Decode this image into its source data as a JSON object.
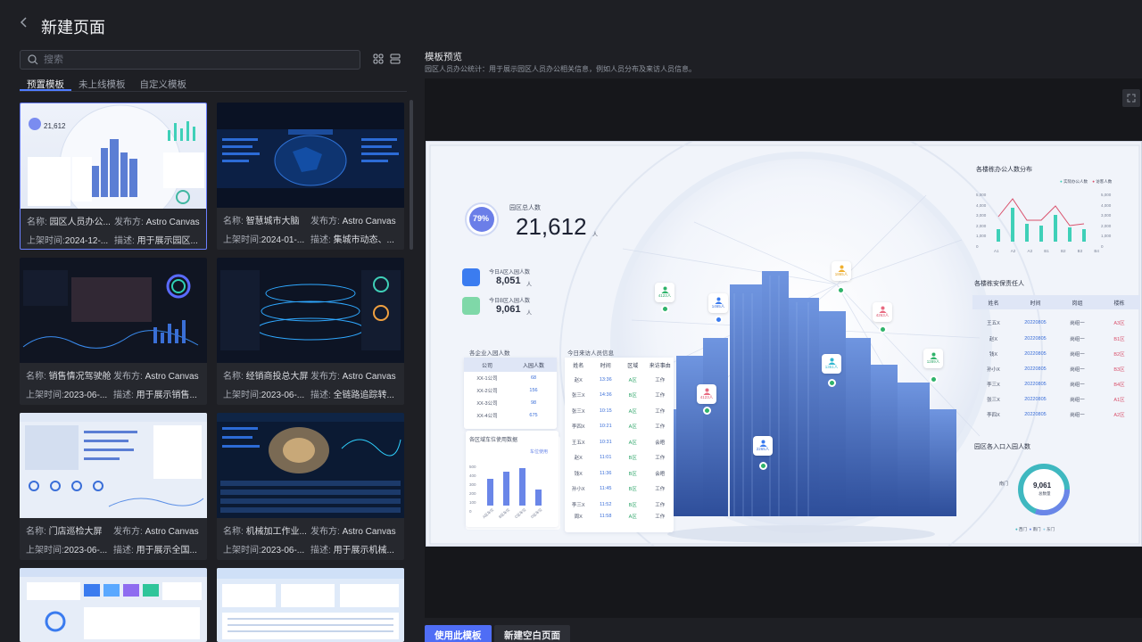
{
  "header": {
    "back_icon": "chevron-left-icon",
    "title": "新建页面"
  },
  "search": {
    "placeholder": "搜索"
  },
  "tabs": [
    {
      "label": "预置模板",
      "active": true
    },
    {
      "label": "未上线模板",
      "active": false
    },
    {
      "label": "自定义模板",
      "active": false
    }
  ],
  "labels": {
    "name": "名称:",
    "publisher": "发布方:",
    "date": "上架时间:",
    "desc": "描述:"
  },
  "cards": [
    {
      "name": "园区人员办公...",
      "publisher": "Astro Canvas",
      "date": "2024-12-...",
      "desc": "用于展示园区...",
      "selected": true
    },
    {
      "name": "智慧城市大脑",
      "publisher": "Astro Canvas",
      "date": "2024-01-...",
      "desc": "集城市动态、..."
    },
    {
      "name": "销售情况驾驶舱",
      "publisher": "Astro Canvas",
      "date": "2023-06-...",
      "desc": "用于展示销售..."
    },
    {
      "name": "经销商投总大屏",
      "publisher": "Astro Canvas",
      "date": "2023-06-...",
      "desc": "全链路追踪转..."
    },
    {
      "name": "门店巡检大屏",
      "publisher": "Astro Canvas",
      "date": "2023-06-...",
      "desc": "用于展示全国..."
    },
    {
      "name": "机械加工作业...",
      "publisher": "Astro Canvas",
      "date": "2023-06-...",
      "desc": "用于展示机械..."
    },
    {
      "name": "",
      "publisher": "",
      "date": "",
      "desc": ""
    },
    {
      "name": "",
      "publisher": "",
      "date": "",
      "desc": ""
    }
  ],
  "preview": {
    "title": "模板预览",
    "description": "园区人员办公统计：用于展示园区人员办公相关信息，例如人员分布及来访人员信息。",
    "fullscreen_icon": "expand-icon"
  },
  "buttons": {
    "use_template": "使用此模板",
    "new_blank": "新建空白页面"
  },
  "dashboard": {
    "percent": "79%",
    "total_label": "园区总人数",
    "total_value": "21,612",
    "total_unit": "人",
    "a_label": "今日A区入园人数",
    "a_value": "8,051",
    "a_unit": "人",
    "b_label": "今日B区入园人数",
    "b_value": "9,061",
    "b_unit": "人",
    "company_title": "各企业入园人数",
    "company_head": [
      "公司",
      "入园人数"
    ],
    "company_rows": [
      [
        "XX-1公司",
        "68"
      ],
      [
        "XX-2公司",
        "156"
      ],
      [
        "XX-3公司",
        "98"
      ],
      [
        "XX-4公司",
        "675"
      ]
    ],
    "parking_title": "各区域车位使用数据",
    "parking_legend": "车位使用",
    "parking_y": [
      "500",
      "400",
      "300",
      "200",
      "100",
      "0"
    ],
    "parking_x": [
      "A区车位",
      "B区车位",
      "C区车位",
      "D区车位"
    ],
    "visitors_title": "今日来访人员信息",
    "visitors_head": [
      "姓名",
      "时间",
      "区域",
      "来访事由"
    ],
    "visitors_rows": [
      [
        "赵X",
        "13:36",
        "A区",
        "工作"
      ],
      [
        "张三X",
        "14:36",
        "B区",
        "工作"
      ],
      [
        "张三X",
        "10:15",
        "A区",
        "工作"
      ],
      [
        "李四X",
        "10:21",
        "A区",
        "工作"
      ],
      [
        "王五X",
        "10:31",
        "A区",
        "会晤"
      ],
      [
        "赵X",
        "11:01",
        "B区",
        "工作"
      ],
      [
        "钱X",
        "11:36",
        "B区",
        "会晤"
      ],
      [
        "孙小X",
        "11:45",
        "B区",
        "工作"
      ],
      [
        "李三X",
        "11:52",
        "B区",
        "工作"
      ],
      [
        "周X",
        "11:58",
        "A区",
        "工作"
      ]
    ],
    "building_title": "各楼栋办公人数分布",
    "building_legend": [
      "实际办公人数",
      "访客人数"
    ],
    "building_y": [
      "5,000",
      "4,000",
      "3,000",
      "2,000",
      "1,000",
      "0"
    ],
    "building_x": [
      "A1",
      "A2",
      "A3",
      "B1",
      "B2",
      "B3",
      "B4"
    ],
    "security_title": "各楼栋安保责任人",
    "security_head": [
      "姓名",
      "时间",
      "岗组",
      "楼栋"
    ],
    "security_rows": [
      [
        "王五X",
        "20220805",
        "岗组一",
        "A3区"
      ],
      [
        "赵X",
        "20220805",
        "岗组一",
        "B1区"
      ],
      [
        "钱X",
        "20220805",
        "岗组一",
        "B2区"
      ],
      [
        "孙小X",
        "20220805",
        "岗组一",
        "B3区"
      ],
      [
        "李三X",
        "20220805",
        "岗组一",
        "B4区"
      ],
      [
        "张三X",
        "20220805",
        "岗组一",
        "A1区"
      ],
      [
        "李四X",
        "20220805",
        "岗组一",
        "A2区"
      ]
    ],
    "gate_title": "园区各入口入园人数",
    "gate_value": "9,061",
    "gate_sub": "总数量",
    "gate_label": "南门",
    "gate_legend": [
      "西门",
      "南门",
      "东门"
    ],
    "pins": [
      "4123人",
      "1465人",
      "1865人",
      "4263人",
      "1351人",
      "4123人",
      "2265人",
      "1289人"
    ]
  },
  "colors": {
    "accent": "#4f6df5",
    "active_tab": "#4f7cff",
    "selected_border": "#6b7fff"
  }
}
